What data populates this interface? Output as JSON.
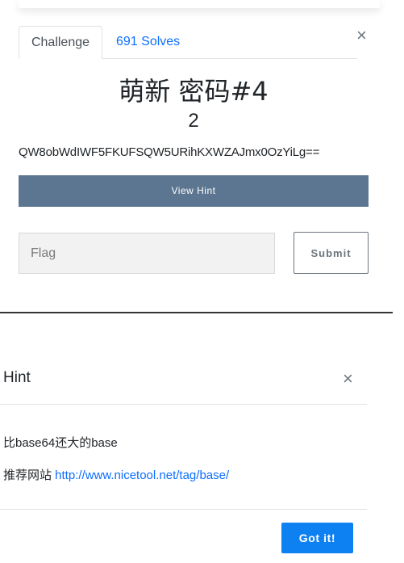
{
  "challenge_modal": {
    "tabs": [
      {
        "label": "Challenge"
      },
      {
        "label": "691 Solves"
      }
    ],
    "close_symbol": "×",
    "title": "萌新 密码#4",
    "points": "2",
    "description": "QW8obWdIWF5FKUFSQW5URihKXWZAJmx0OzYiLg==",
    "view_hint_label": "View Hint",
    "flag_placeholder": "Flag",
    "submit_label": "Submit"
  },
  "hint_modal": {
    "title": "Hint",
    "close_symbol": "×",
    "line1": "比base64还大的base",
    "line2_prefix": "推荐网站 ",
    "line2_link": "http://www.nicetool.net/tag/base/",
    "got_it_label": "Got it!"
  },
  "colors": {
    "hint_bar": "#5c7590",
    "link": "#0d6efd",
    "primary_button": "#0d80f2"
  }
}
